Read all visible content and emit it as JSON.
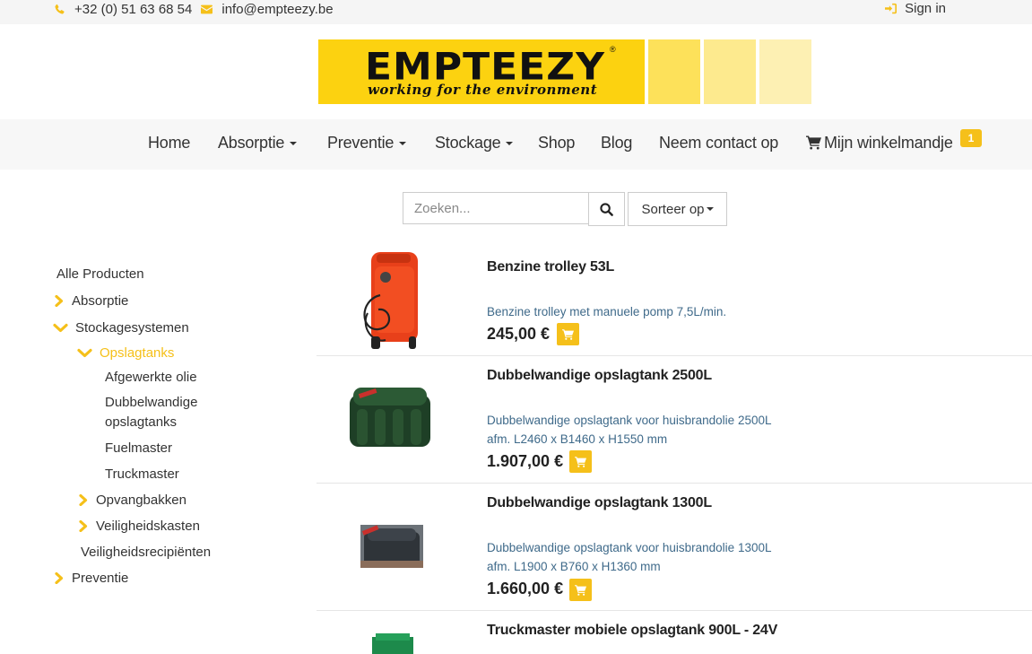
{
  "topbar": {
    "phone": "+32 (0) 51 63 68 54",
    "email": "info@empteezy.be",
    "signin": "Sign in"
  },
  "logo": {
    "brand": "EMPTEEZY",
    "registered": "®",
    "tagline": "working for the environment",
    "colors": {
      "primary": "#fcd210",
      "squares": [
        "#fde15a",
        "#fdea8e",
        "#fdf0b3"
      ]
    }
  },
  "nav": {
    "home": "Home",
    "absorptie": "Absorptie",
    "preventie": "Preventie",
    "stockage": "Stockage",
    "shop": "Shop",
    "blog": "Blog",
    "contact": "Neem contact op",
    "cart": "Mijn winkelmandje",
    "cart_count": "1"
  },
  "search": {
    "placeholder": "Zoeken...",
    "sort_label": "Sorteer op"
  },
  "sidebar": {
    "all": "Alle Producten",
    "absorptie": "Absorptie",
    "stockage": "Stockagesystemen",
    "opslagtanks": "Opslagtanks",
    "afgewerkte_olie": "Afgewerkte olie",
    "dubbelwandige_line1": "Dubbelwandige",
    "dubbelwandige_line2": "opslagtanks",
    "fuelmaster": "Fuelmaster",
    "truckmaster": "Truckmaster",
    "opvangbakken": "Opvangbakken",
    "veiligheidskasten": "Veiligheidskasten",
    "veiligheidsrecipienten": "Veiligheidsrecipiënten",
    "preventie": "Preventie"
  },
  "products": [
    {
      "title": "Benzine trolley 53L",
      "desc1": "Benzine trolley met manuele pomp 7,5L/min.",
      "desc2": "",
      "price": "245,00 €"
    },
    {
      "title": "Dubbelwandige opslagtank 2500L",
      "desc1": "Dubbelwandige opslagtank voor huisbrandolie 2500L",
      "desc2": "afm. L2460 x B1460 x H1550 mm",
      "price": "1.907,00 €"
    },
    {
      "title": "Dubbelwandige opslagtank 1300L",
      "desc1": "Dubbelwandige opslagtank voor huisbrandolie 1300L",
      "desc2": "afm. L1900 x B760 x H1360 mm",
      "price": "1.660,00 €"
    },
    {
      "title": "Truckmaster mobiele opslagtank 900L - 24V"
    }
  ],
  "colors": {
    "accent": "#f5c01a",
    "link": "#3f6a8a",
    "nav_bg": "#f7f7f7"
  },
  "icons": [
    "phone-icon",
    "envelope-icon",
    "sign-in-icon",
    "cart-icon",
    "search-icon",
    "chevron-right-icon",
    "chevron-down-icon"
  ]
}
